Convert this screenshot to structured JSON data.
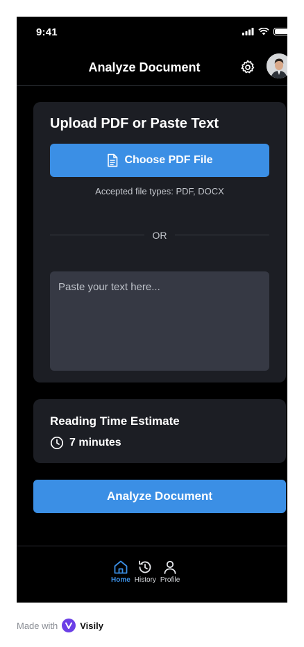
{
  "status_bar": {
    "time": "9:41"
  },
  "header": {
    "title": "Analyze Document",
    "settings_icon": "gear-icon",
    "avatar_icon": "user-avatar"
  },
  "upload": {
    "title": "Upload PDF or Paste Text",
    "choose_label": "Choose PDF File",
    "accepted_types": "Accepted file types: PDF, DOCX",
    "divider_text": "OR",
    "paste_placeholder": "Paste your text here..."
  },
  "reading": {
    "title": "Reading Time Estimate",
    "value": "7 minutes"
  },
  "analyze_button": "Analyze Document",
  "nav": {
    "items": [
      {
        "label": "Home",
        "icon": "home-icon",
        "active": true
      },
      {
        "label": "History",
        "icon": "history-icon",
        "active": false
      },
      {
        "label": "Profile",
        "icon": "user-icon",
        "active": false
      }
    ]
  },
  "footer": {
    "made_with": "Made with",
    "brand": "Visily"
  },
  "colors": {
    "accent": "#3b8fe5",
    "card": "#1c1e24",
    "input": "#363944",
    "background": "#000000"
  }
}
